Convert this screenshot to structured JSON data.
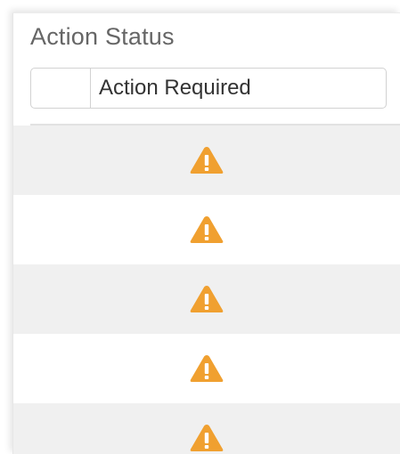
{
  "column": {
    "title": "Action Status",
    "filter": {
      "operator": "",
      "value": "Action Required"
    }
  },
  "rows": [
    {
      "icon": "warning-triangle-icon"
    },
    {
      "icon": "warning-triangle-icon"
    },
    {
      "icon": "warning-triangle-icon"
    },
    {
      "icon": "warning-triangle-icon"
    },
    {
      "icon": "warning-triangle-icon"
    }
  ],
  "colors": {
    "warning": "#f0a030",
    "row_alt": "#f0f0f0",
    "title_text": "#666666"
  }
}
